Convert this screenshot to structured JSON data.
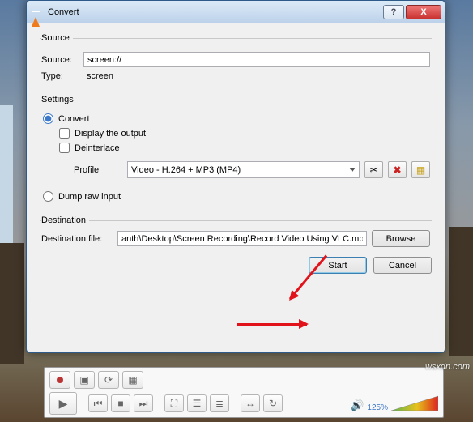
{
  "window": {
    "title": "Convert",
    "help": "?",
    "close": "X"
  },
  "source": {
    "legend": "Source",
    "source_label": "Source:",
    "source_value": "screen://",
    "type_label": "Type:",
    "type_value": "screen"
  },
  "settings": {
    "legend": "Settings",
    "convert_label": "Convert",
    "display_output": "Display the output",
    "deinterlace": "Deinterlace",
    "profile_label": "Profile",
    "profile_value": "Video - H.264 + MP3 (MP4)",
    "dump_label": "Dump raw input"
  },
  "destination": {
    "legend": "Destination",
    "file_label": "Destination file:",
    "file_value": "anth\\Desktop\\Screen Recording\\Record Video Using VLC.mp4",
    "browse": "Browse"
  },
  "footer": {
    "start": "Start",
    "cancel": "Cancel"
  },
  "player": {
    "volume_pct": "125%"
  },
  "watermark": "wsxdn.com"
}
